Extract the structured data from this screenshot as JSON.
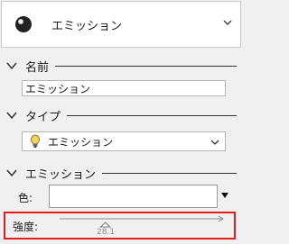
{
  "material": {
    "name": "エミッション",
    "thumb_icon": "material-sphere-icon",
    "chevron_icon": "chevron-down-icon"
  },
  "sections": {
    "name": {
      "title": "名前",
      "value": "エミッション"
    },
    "type": {
      "title": "タイプ",
      "selected": "エミッション",
      "icon": "bulb-icon"
    },
    "emission": {
      "title": "エミッション",
      "color_label": "色:",
      "color_value": "#ffffff",
      "intensity_label": "強度:",
      "intensity_value": "28.1",
      "intensity_fraction": 0.28
    }
  },
  "colors": {
    "highlight": "#e41e1e",
    "background": "#f0f0f0"
  }
}
